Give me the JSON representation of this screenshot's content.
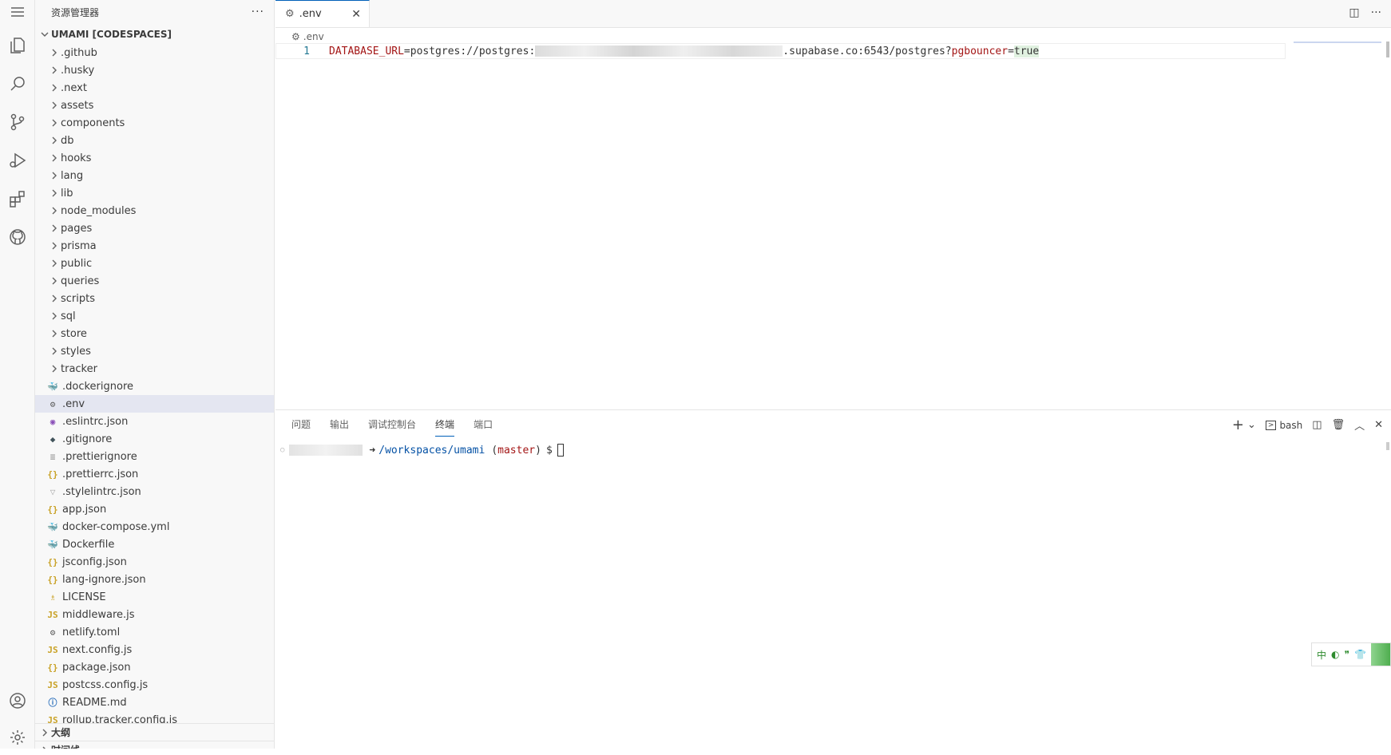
{
  "activity_bar": {
    "icons": [
      "menu-icon",
      "explorer-icon",
      "search-icon",
      "source-control-icon",
      "run-debug-icon",
      "extensions-icon",
      "github-icon",
      "account-icon",
      "settings-gear-icon"
    ]
  },
  "sidebar": {
    "title": "资源管理器",
    "more": "···",
    "project": "UMAMI [CODESPACES]",
    "folders": [
      ".github",
      ".husky",
      ".next",
      "assets",
      "components",
      "db",
      "hooks",
      "lang",
      "lib",
      "node_modules",
      "pages",
      "prisma",
      "public",
      "queries",
      "scripts",
      "sql",
      "store",
      "styles",
      "tracker"
    ],
    "files": [
      {
        "name": ".dockerignore",
        "icon": "docker-icon",
        "glyph": "🐳",
        "color": "#4a6a8a"
      },
      {
        "name": ".env",
        "icon": "gear-icon",
        "glyph": "⚙",
        "color": "#616161",
        "active": true
      },
      {
        "name": ".eslintrc.json",
        "icon": "eslint-icon",
        "glyph": "◉",
        "color": "#8a4fb8"
      },
      {
        "name": ".gitignore",
        "icon": "git-icon",
        "glyph": "◆",
        "color": "#41535b"
      },
      {
        "name": ".prettierignore",
        "icon": "lines-icon",
        "glyph": "≡",
        "color": "#999999"
      },
      {
        "name": ".prettierrc.json",
        "icon": "json-icon",
        "glyph": "{}",
        "color": "#c9a227"
      },
      {
        "name": ".stylelintrc.json",
        "icon": "stylelint-icon",
        "glyph": "▽",
        "color": "#aaaaaa"
      },
      {
        "name": "app.json",
        "icon": "json-icon",
        "glyph": "{}",
        "color": "#c9a227"
      },
      {
        "name": "docker-compose.yml",
        "icon": "docker-compose-icon",
        "glyph": "🐳",
        "color": "#d9534f"
      },
      {
        "name": "Dockerfile",
        "icon": "docker-icon",
        "glyph": "🐳",
        "color": "#2496ed"
      },
      {
        "name": "jsconfig.json",
        "icon": "json-icon",
        "glyph": "{}",
        "color": "#c9a227"
      },
      {
        "name": "lang-ignore.json",
        "icon": "json-icon",
        "glyph": "{}",
        "color": "#c9a227"
      },
      {
        "name": "LICENSE",
        "icon": "license-icon",
        "glyph": "♗",
        "color": "#c9a227"
      },
      {
        "name": "middleware.js",
        "icon": "js-icon",
        "glyph": "JS",
        "color": "#c9a227"
      },
      {
        "name": "netlify.toml",
        "icon": "gear-icon",
        "glyph": "⚙",
        "color": "#616161"
      },
      {
        "name": "next.config.js",
        "icon": "js-icon",
        "glyph": "JS",
        "color": "#c9a227"
      },
      {
        "name": "package.json",
        "icon": "json-icon",
        "glyph": "{}",
        "color": "#c9a227"
      },
      {
        "name": "postcss.config.js",
        "icon": "js-icon",
        "glyph": "JS",
        "color": "#c9a227"
      },
      {
        "name": "README.md",
        "icon": "info-icon",
        "glyph": "ⓘ",
        "color": "#2a6ebb"
      },
      {
        "name": "rollup.tracker.config.js",
        "icon": "js-icon",
        "glyph": "JS",
        "color": "#c9a227"
      }
    ],
    "sections": [
      "大纲",
      "时间线"
    ]
  },
  "editor": {
    "tab_label": ".env",
    "tab_close": "✕",
    "breadcrumb": ".env",
    "line_number": "1",
    "code": {
      "var": "DATABASE_URL",
      "eq": "=",
      "prefix": "postgres://postgres:",
      "suffix": ".supabase.co:6543/postgres?",
      "param": "pgbouncer",
      "eq2": "=",
      "val": "true"
    },
    "actions": [
      "◫",
      "···"
    ]
  },
  "panel": {
    "tabs": [
      "问题",
      "输出",
      "调试控制台",
      "终端",
      "端口"
    ],
    "active_tab": "终端",
    "shell": "bash",
    "actions": {
      "add": "+",
      "dropdown": "⌄",
      "split": "◫",
      "trash": "🗑",
      "maximize": "︿",
      "close": "✕"
    },
    "terminal": {
      "arrow": "➜",
      "path": "/workspaces/umami",
      "branch_open": "(",
      "branch": "master",
      "branch_close": ")",
      "dollar": "$"
    }
  },
  "ime": {
    "lang": "中",
    "moon": "◐",
    "punct": "❞",
    "shirt": "👕"
  },
  "colors": {
    "accent": "#005fb8",
    "active_row": "#e4e6f1",
    "sidebar_bg": "#f8f8f8"
  }
}
